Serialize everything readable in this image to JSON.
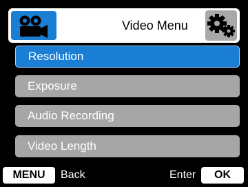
{
  "header": {
    "title": "Video Menu",
    "mode_icon": "video-camera-icon",
    "settings_icon": "settings-gears-icon"
  },
  "menu": {
    "selected_index": 0,
    "items": [
      {
        "label": "Resolution"
      },
      {
        "label": "Exposure"
      },
      {
        "label": "Audio Recording"
      },
      {
        "label": "Video Length"
      }
    ]
  },
  "footer": {
    "menu_key": "MENU",
    "back_label": "Back",
    "enter_label": "Enter",
    "ok_key": "OK"
  },
  "colors": {
    "selected": "#1a7fd4",
    "item": "#a6a6a6",
    "background": "#000000"
  }
}
